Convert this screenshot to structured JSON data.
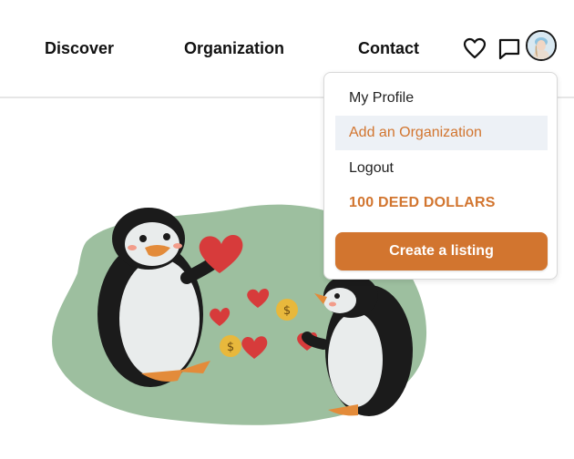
{
  "nav": {
    "links": [
      {
        "label": "Discover"
      },
      {
        "label": "Organization"
      },
      {
        "label": "Contact"
      }
    ],
    "icons": [
      "heart-icon",
      "chat-icon"
    ]
  },
  "user_menu": {
    "items": [
      {
        "label": "My Profile"
      },
      {
        "label": "Add an Organization",
        "highlighted": true
      },
      {
        "label": "Logout"
      }
    ],
    "deed_dollars": "100 DEED DOLLARS",
    "cta_label": "Create a listing"
  },
  "colors": {
    "accent": "#d2752f",
    "highlight_bg": "#edf1f6",
    "blob": "#9dbf9f",
    "heart": "#d73b3b",
    "coin": "#e8b83c"
  }
}
